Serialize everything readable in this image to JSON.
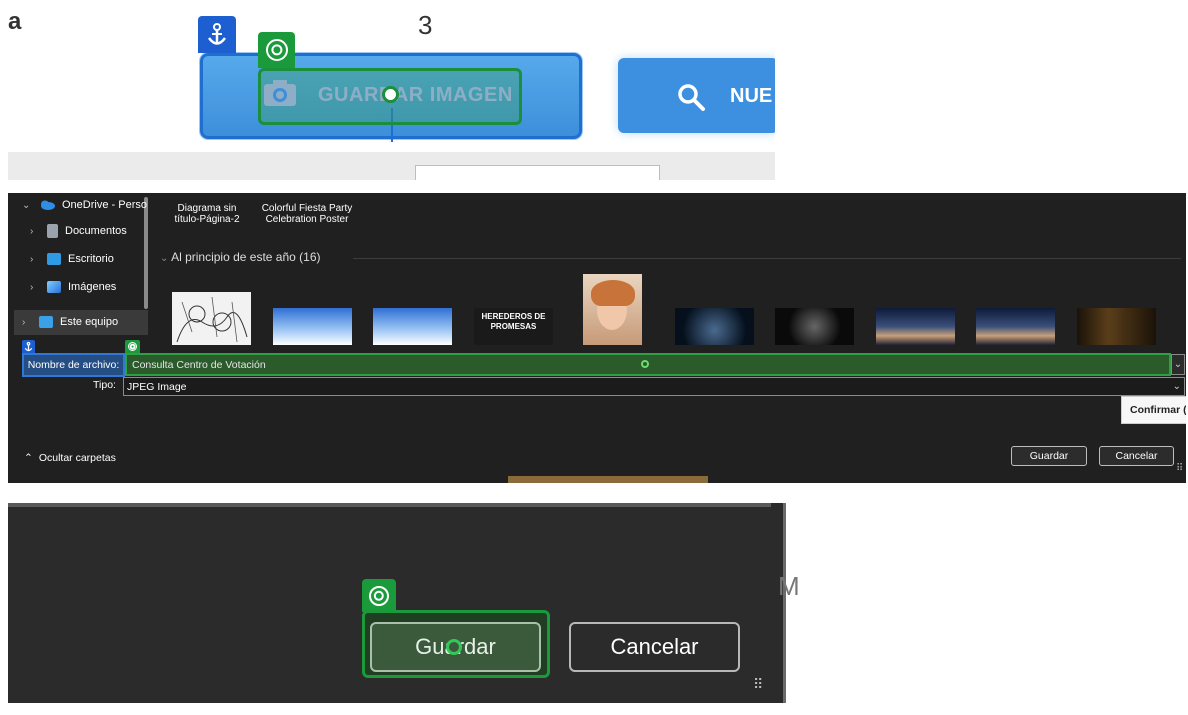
{
  "panel1": {
    "letter": "a",
    "step": "3",
    "save_button_label": "GUARDAR IMAGEN",
    "new_button_label": "NUE"
  },
  "dialog": {
    "sidebar": [
      {
        "label": "OneDrive - Perso",
        "chevron": "⌄",
        "icon": "cloud-icon",
        "color": "#2f8de4"
      },
      {
        "label": "Documentos",
        "chevron": "›",
        "icon": "document-icon",
        "color": "#9aa3ad"
      },
      {
        "label": "Escritorio",
        "chevron": "›",
        "icon": "desktop-icon",
        "color": "#2f9be4"
      },
      {
        "label": "Imágenes",
        "chevron": "›",
        "icon": "pictures-icon",
        "color": "#3a8ee0"
      },
      {
        "label": "Este equipo",
        "chevron": "›",
        "icon": "computer-icon",
        "color": "#3aa0e8"
      }
    ],
    "top_files": [
      {
        "caption": "Diagrama sin título-Página-2"
      },
      {
        "caption": "Colorful Fiesta Party Celebration Poster"
      }
    ],
    "section_title": "Al principio de este año (16)",
    "thumb_text": "HEREDEROS DE PROMESAS",
    "filename_label": "Nombre de archivo:",
    "filename_value": "Consulta Centro de Votación",
    "type_label": "Tipo:",
    "type_value": "JPEG Image",
    "tooltip": "Confirmar (",
    "hide_folders": "Ocultar carpetas",
    "save_label": "Guardar",
    "cancel_label": "Cancelar"
  },
  "panel3": {
    "save_label": "Guardar",
    "cancel_label": "Cancelar",
    "side_letter": "M"
  },
  "colors": {
    "anchor": "#1d5fd0",
    "target": "#1a9a3a",
    "dialog_bg": "#202020",
    "primary_blue": "#3d8fe0"
  }
}
